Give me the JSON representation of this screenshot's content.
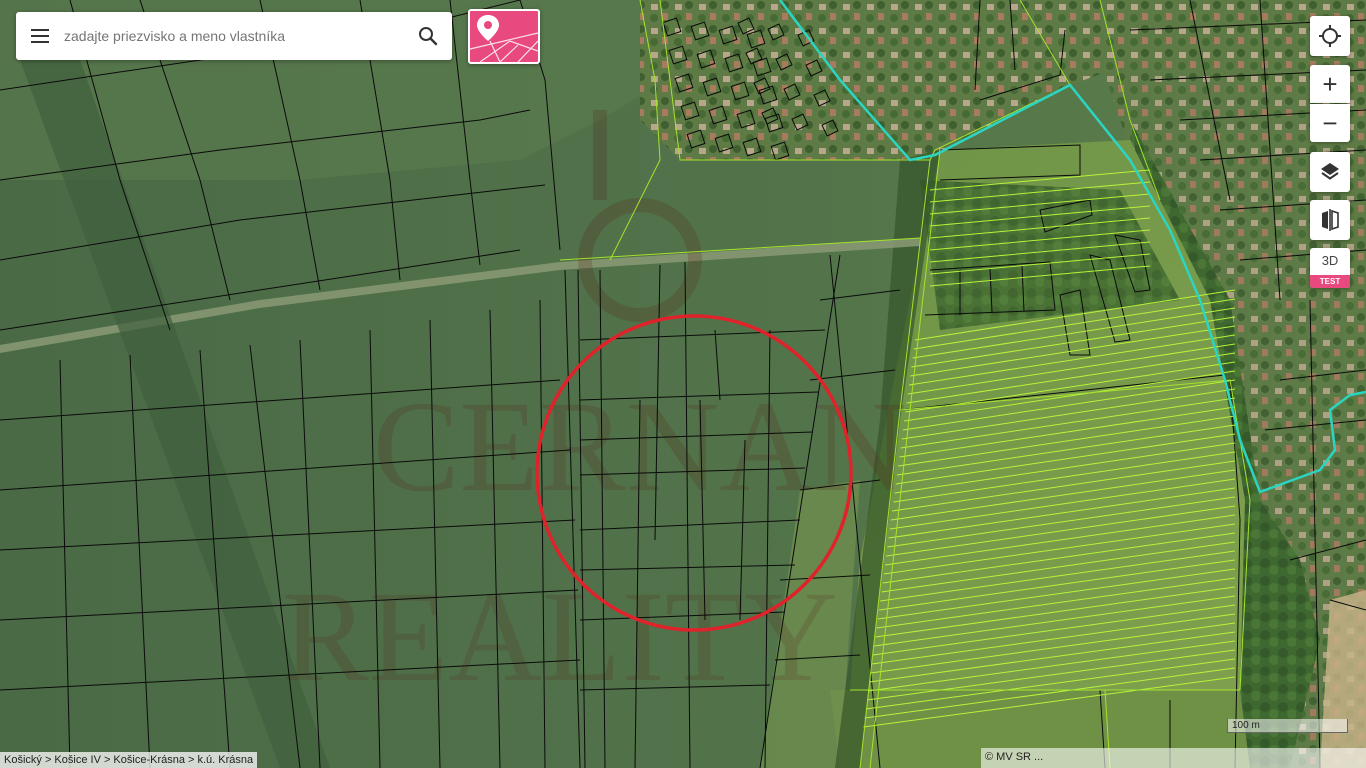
{
  "search": {
    "placeholder": "zadajte priezvisko a meno vlastníka",
    "menu_icon": "hamburger-menu-icon",
    "search_icon": "magnifier-icon"
  },
  "toolbar": {
    "cadastre_icon": "cadastre-parcel-pin-icon",
    "accent_color": "#e8497e"
  },
  "map_controls": {
    "locate_icon": "crosshair-locate-icon",
    "zoom_in": "+",
    "zoom_out": "−",
    "layers_icon": "layers-icon",
    "compare_icon": "split-compare-icon",
    "view_3d": "3D",
    "test_badge": "TEST"
  },
  "breadcrumb": "Košický > Košice IV > Košice-Krásna > k.ú. Krásna",
  "copyright": "© MV SR ...",
  "scale": "100 m",
  "watermark": [
    "CERNAN",
    "REALITY"
  ],
  "colors": {
    "parcel_lines": "#000000",
    "cadastre_green_lines": "#a6e22e",
    "boundary_cyan": "#2ad6c2",
    "highlight_circle": "#e0232b"
  }
}
